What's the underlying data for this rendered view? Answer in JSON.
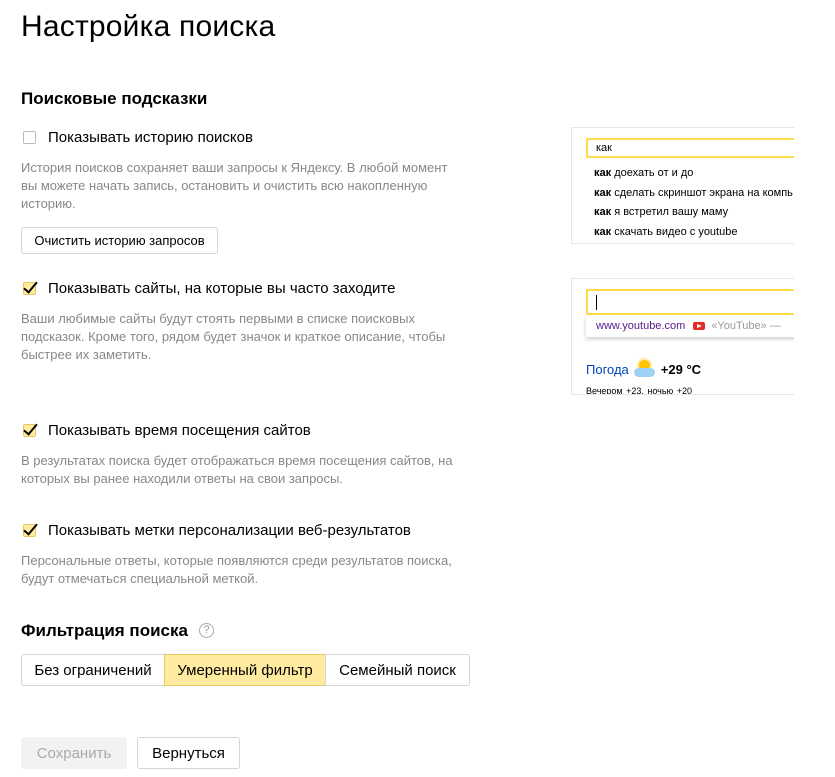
{
  "page": {
    "title": "Настройка поиска"
  },
  "suggest_section": {
    "title": "Поисковые подсказки",
    "history": {
      "label": "Показывать историю поисков",
      "checked": false,
      "desc_lines": [
        "История поисков сохраняет ваши запросы к Яндексу. В любой момент",
        "вы можете начать запись, остановить и очистить всю накопленную",
        "историю."
      ],
      "clear_button": "Очистить историю запросов"
    },
    "frequent_sites": {
      "label": "Показывать сайты, на которые вы часто заходите",
      "checked": true,
      "desc_lines": [
        "Ваши любимые сайты будут стоять первыми в списке поисковых",
        "подсказок. Кроме того, рядом будет значок и краткое описание, чтобы",
        "быстрее их заметить."
      ]
    },
    "visit_time": {
      "label": "Показывать время посещения сайтов",
      "checked": true,
      "desc_lines": [
        "В результатах поиска будет отображаться время посещения сайтов, на",
        "которых вы ранее находили ответы на свои запросы."
      ]
    },
    "personal_marks": {
      "label": "Показывать метки персонализации веб-результатов",
      "checked": true,
      "desc_lines": [
        "Персональные ответы, которые появляются среди результатов поиска,",
        "будут отмечаться специальной меткой."
      ]
    }
  },
  "preview_suggest": {
    "query": "как",
    "items": [
      {
        "bold": "как",
        "rest": " доехать от и до"
      },
      {
        "bold": "как",
        "rest": " сделать скриншот экрана на компь"
      },
      {
        "bold": "как",
        "rest": " я встретил вашу маму"
      },
      {
        "bold": "как",
        "rest": " скачать видео с youtube"
      }
    ]
  },
  "preview_sites": {
    "site_url": "www.youtube.com",
    "site_title": "«YouTube» —",
    "weather_link": "Погода",
    "weather_temp": "+29 °C",
    "weather_sub": "Вечером +23,  ночью +20",
    "icons": {
      "site": "youtube-icon",
      "weather": "sun-cloud-icon"
    }
  },
  "filter_section": {
    "title": "Фильтрация поиска",
    "help_symbol": "?",
    "options": [
      "Без ограничений",
      "Умеренный фильтр",
      "Семейный поиск"
    ],
    "selected": "Умеренный фильтр"
  },
  "actions": {
    "save": "Сохранить",
    "back": "Вернуться"
  },
  "colors": {
    "accent_yellow": "#ffeba0",
    "accent_border": "#e8c760",
    "link": "#0044bb",
    "muted": "#888888"
  }
}
